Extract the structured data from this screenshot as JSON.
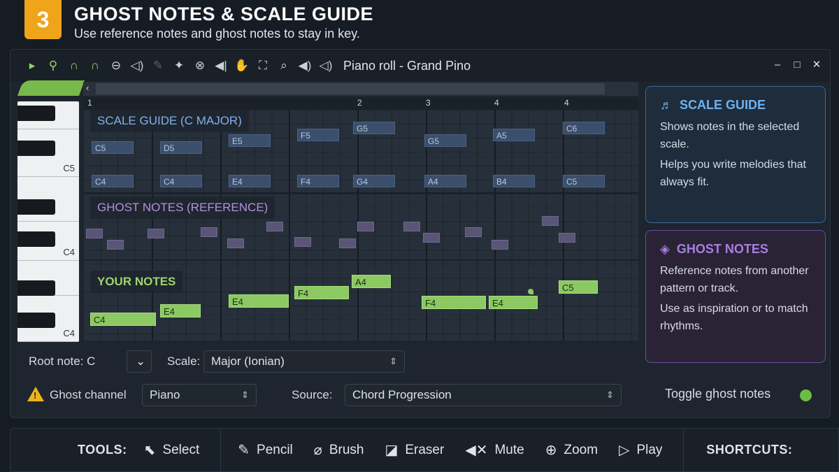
{
  "header": {
    "step": "3",
    "title": "GHOST NOTES & SCALE GUIDE",
    "subtitle": "Use reference notes and ghost notes to stay in key."
  },
  "window": {
    "title": "Piano roll - Grand Pino",
    "controls": {
      "minimize": "–",
      "maximize": "□",
      "close": "✕"
    },
    "toolbar_icons": [
      "play-icon",
      "magnet-icon",
      "slide-icon",
      "portamento-icon",
      "stop-circle-icon",
      "speaker-icon",
      "pencil-icon",
      "brush-icon",
      "delete-icon",
      "mute-icon",
      "slice-icon",
      "select-icon",
      "zoom-icon",
      "volume-icon"
    ]
  },
  "keyboard": {
    "labels": [
      "C5",
      "C4",
      "C4"
    ]
  },
  "timeline": {
    "bar_numbers": [
      "1",
      "2",
      "3",
      "4",
      "4"
    ]
  },
  "sections": {
    "scale": "SCALE GUIDE (C MAJOR)",
    "ghost": "GHOST NOTES (REFERENCE)",
    "yours": "YOUR NOTES"
  },
  "scale_notes_upper": [
    "C5",
    "D5",
    "E5",
    "F5",
    "G5",
    "G5",
    "A5",
    "C6"
  ],
  "scale_notes_lower": [
    "C4",
    "C4",
    "E4",
    "F4",
    "G4",
    "A4",
    "B4",
    "C5"
  ],
  "your_notes": [
    "C4",
    "E4",
    "E4",
    "F4",
    "A4",
    "F4",
    "E4",
    "C5"
  ],
  "controls": {
    "root_label": "Root note: C",
    "root_dropdown": "⌄",
    "scale_label": "Scale:",
    "scale_value": "Major (Ionian)",
    "ghost_channel_label": "Ghost channel",
    "ghost_channel_value": "Piano",
    "source_label": "Source:",
    "source_value": "Chord Progression"
  },
  "side": {
    "scale_title": "SCALE GUIDE",
    "scale_text_1": "Shows notes in the selected scale.",
    "scale_text_2": "Helps you write melodies that always fit.",
    "ghost_title": "GHOST NOTES",
    "ghost_text_1": "Reference notes from another pattern or track.",
    "ghost_text_2": "Use as inspiration or to match rhythms.",
    "toggle_label": "Toggle ghost notes",
    "toggle_color": "#6dbd45"
  },
  "tools": {
    "label": "TOOLS:",
    "items": [
      "Select",
      "Pencil",
      "Brush",
      "Eraser",
      "Mute",
      "Zoom",
      "Play"
    ],
    "shortcuts_label": "SHORTCUTS:"
  },
  "colors": {
    "accent_orange": "#f0a41a",
    "scale_blue": "#3b4f6d",
    "ghost_purple": "#5a5576",
    "your_green": "#8cc963"
  }
}
